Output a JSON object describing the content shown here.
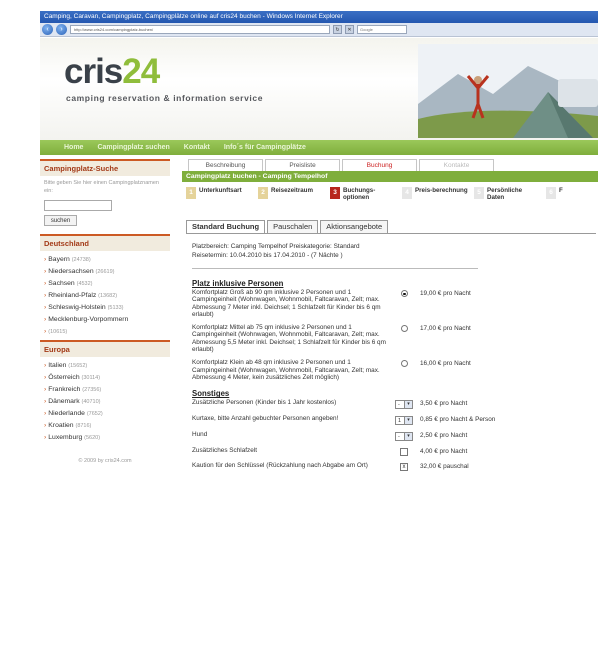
{
  "browser": {
    "title": "Camping, Caravan, Campingplatz, Campingplätze online auf cris24 buchen - Windows Internet Explorer",
    "url": "http://www.cris24.com/campingplatz-buchen/",
    "search_placeholder": "Google"
  },
  "site": {
    "logo_text": "cris",
    "logo_num": "24",
    "tagline": "camping reservation & information service"
  },
  "nav": [
    "Home",
    "Campingplatz suchen",
    "Kontakt",
    "Info´s für Campingplätze"
  ],
  "sidebar": {
    "search_title": "Campingplatz-Suche",
    "search_hint": "Bitte geben Sie hier einen Campingplatznamen ein:",
    "search_button": "suchen",
    "germany_title": "Deutschland",
    "germany": [
      {
        "name": "Bayern",
        "count": "(24738)"
      },
      {
        "name": "Niedersachsen",
        "count": "(26619)"
      },
      {
        "name": "Sachsen",
        "count": "(4532)"
      },
      {
        "name": "Rheinland-Pfalz",
        "count": "(13682)"
      },
      {
        "name": "Schleswig-Holstein",
        "count": "(5133)"
      },
      {
        "name": "Mecklenburg-Vorpommern",
        "count": ""
      }
    ],
    "mv_count": "(10615)",
    "europe_title": "Europa",
    "europe": [
      {
        "name": "Italien",
        "count": "(15652)"
      },
      {
        "name": "Österreich",
        "count": "(30114)"
      },
      {
        "name": "Frankreich",
        "count": "(27356)"
      },
      {
        "name": "Dänemark",
        "count": "(40710)"
      },
      {
        "name": "Niederlande",
        "count": "(7652)"
      },
      {
        "name": "Kroatien",
        "count": "(8716)"
      },
      {
        "name": "Luxemburg",
        "count": "(5620)"
      }
    ],
    "copyright": "© 2009 by cris24.com"
  },
  "main": {
    "top_tabs": [
      "Beschreibung",
      "Preisliste",
      "Buchung",
      "Kontakte"
    ],
    "booking_title": "Campingplatz buchen - Camping Tempelhof",
    "steps": [
      {
        "num": "1",
        "label": "Unterkunftsart"
      },
      {
        "num": "2",
        "label": "Reisezeitraum"
      },
      {
        "num": "3",
        "label": "Buchungs-optionen"
      },
      {
        "num": "4",
        "label": "Preis-berechnung"
      },
      {
        "num": "5",
        "label": "Persönliche Daten"
      },
      {
        "num": "6",
        "label": "F"
      }
    ],
    "sub_tabs": [
      "Standard Buchung",
      "Pauschalen",
      "Aktionsangebote"
    ],
    "area_line": "Platzbereich: Camping Tempelhof   Preiskategorie: Standard",
    "travel_line": "Reisetermin: 10.04.2010 bis 17.04.2010 - (7 Nächte )",
    "section1_title": "Platz inklusive Personen",
    "places": [
      {
        "desc": "Komfortplatz Groß ab 90 qm inklusive 2 Personen und 1 Campingeinheit (Wohnwagen, Wohnmobil, Faltcaravan, Zelt; max. Abmessung 7 Meter inkl. Deichsel; 1 Schlafzelt für Kinder bis 6 qm erlaubt)",
        "price": "19,00 € pro Nacht",
        "selected": true
      },
      {
        "desc": "Komfortplatz Mittel ab 75 qm inklusive 2 Personen und 1 Campingeinheit (Wohnwagen, Wohnmobil, Faltcaravan, Zelt; max. Abmessung 5,5 Meter inkl. Deichsel; 1 Schlafzelt für Kinder bis 6 qm erlaubt)",
        "price": "17,00 € pro Nacht",
        "selected": false
      },
      {
        "desc": "Komfortplatz Klein ab 48 qm inklusive 2 Personen und 1 Campingeinheit (Wohnwagen, Wohnmobil, Faltcaravan, Zelt; max. Abmessung 4 Meter, kein zusätzliches Zelt möglich)",
        "price": "16,00 € pro Nacht",
        "selected": false
      }
    ],
    "section2_title": "Sonstiges",
    "extras": [
      {
        "desc": "Zusätzliche Personen (Kinder bis 1 Jahr kostenlos)",
        "control": "select",
        "value": "-",
        "price": "3,50 € pro Nacht"
      },
      {
        "desc": "Kurtaxe, bitte Anzahl gebuchter Personen angeben!",
        "control": "select",
        "value": "1",
        "price": "0,85 € pro Nacht & Person"
      },
      {
        "desc": "Hund",
        "control": "select",
        "value": "-",
        "price": "2,50 € pro Nacht"
      },
      {
        "desc": "Zusätzliches Schlafzelt",
        "control": "checkbox",
        "value": "",
        "price": "4,00 € pro Nacht"
      },
      {
        "desc": "Kaution für den Schlüssel (Rückzahlung nach Abgabe am Ort)",
        "control": "checkbox",
        "value": "x",
        "price": "32,00 € pauschal"
      }
    ]
  }
}
